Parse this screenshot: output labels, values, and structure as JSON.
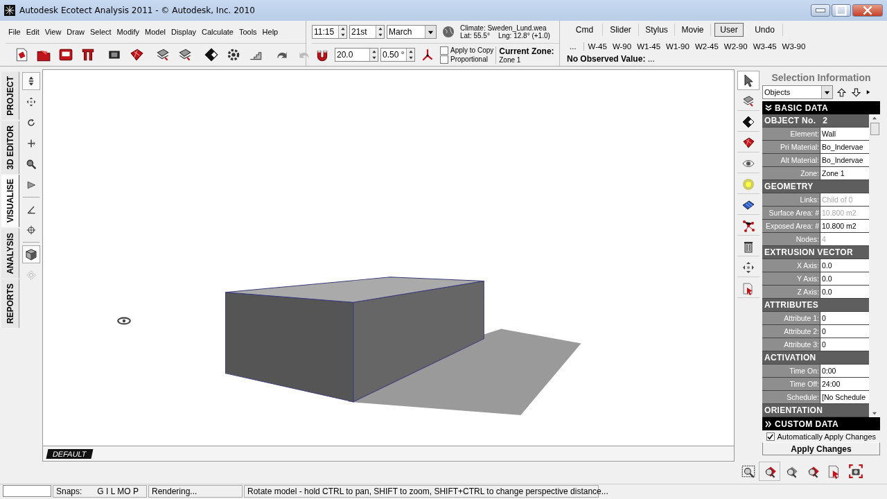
{
  "window": {
    "title": "Autodesk Ecotect Analysis 2011 - © Autodesk, Inc. 2010"
  },
  "menu": [
    "File",
    "Edit",
    "View",
    "Draw",
    "Select",
    "Modify",
    "Model",
    "Display",
    "Calculate",
    "Tools",
    "Help"
  ],
  "date_time": {
    "time": "11:15",
    "day": "21st",
    "month": "March"
  },
  "climate": {
    "file": "Climate: Sweden_Lund.wea",
    "lat": "Lat: 55.5°",
    "lng": "Lng: 12.8° (+1.0)"
  },
  "snap": {
    "distance": "20.0",
    "angle": "0.50 °",
    "options": [
      {
        "label": "Apply to Copy",
        "checked": false
      },
      {
        "label": "Proportional",
        "checked": false
      }
    ]
  },
  "current_zone": {
    "label": "Current Zone:",
    "value": "Zone 1"
  },
  "command_tabs": [
    {
      "label": "Cmd",
      "selected": false
    },
    {
      "label": "Slider",
      "selected": false
    },
    {
      "label": "Stylus",
      "selected": false
    },
    {
      "label": "Movie",
      "selected": false
    },
    {
      "label": "User",
      "selected": true
    },
    {
      "label": "Undo",
      "selected": false
    }
  ],
  "view_buttons": [
    "...",
    "W-45",
    "W-90",
    "W1-45",
    "W1-90",
    "W2-45",
    "W2-90",
    "W3-45",
    "W3-90"
  ],
  "observed_value": "**No Observed Value:** ...",
  "side_tabs": [
    {
      "label": "PROJECT",
      "selected": false
    },
    {
      "label": "3D EDITOR",
      "selected": false
    },
    {
      "label": "VISUALISE",
      "selected": true
    },
    {
      "label": "ANALYSIS",
      "selected": false
    },
    {
      "label": "REPORTS",
      "selected": false
    }
  ],
  "left_tools": [
    {
      "selected": true
    },
    {
      "selected": false
    },
    {
      "selected": false
    },
    {
      "selected": false
    },
    {
      "selected": false
    },
    {
      "selected": false
    },
    {
      "selected": false
    },
    {
      "selected": false
    },
    {
      "selected": true
    },
    {
      "selected": false
    }
  ],
  "viewport": {
    "layer_tab": "DEFAULT"
  },
  "right_tools": [
    {
      "selected": true
    },
    {
      "selected": false
    },
    {
      "selected": false
    },
    {
      "selected": false
    },
    {
      "selected": false
    },
    {
      "selected": false
    },
    {
      "selected": false
    },
    {
      "selected": false
    },
    {
      "selected": false
    },
    {
      "selected": false
    },
    {
      "selected": false
    }
  ],
  "selection_panel": {
    "title": "Selection Information",
    "filter": "Objects",
    "basic_data": {
      "title": "BASIC DATA",
      "expanded": true
    },
    "grid": [
      {
        "kind": "group",
        "title": "OBJECT No.",
        "value": "2"
      },
      {
        "kind": "row",
        "label": "Element:",
        "value": "Wall",
        "disabled": false
      },
      {
        "kind": "row",
        "label": "Pri Material:",
        "value": "Bo_Indervae",
        "disabled": false
      },
      {
        "kind": "row",
        "label": "Alt Material:",
        "value": "Bo_Indervae",
        "disabled": false
      },
      {
        "kind": "row",
        "label": "Zone:",
        "value": "Zone 1",
        "disabled": false
      },
      {
        "kind": "group",
        "title": "GEOMETRY"
      },
      {
        "kind": "row",
        "label": "Links:",
        "value": "Child of 0",
        "disabled": true
      },
      {
        "kind": "row",
        "label": "Surface Area: #",
        "value": "10.800 m2",
        "disabled": true
      },
      {
        "kind": "row",
        "label": "Exposed Area: #",
        "value": "10.800 m2",
        "disabled": false
      },
      {
        "kind": "row",
        "label": "Nodes:",
        "value": "4",
        "disabled": true
      },
      {
        "kind": "group",
        "title": "EXTRUSION VECTOR"
      },
      {
        "kind": "row",
        "label": "X Axis:",
        "value": "0.0",
        "disabled": false
      },
      {
        "kind": "row",
        "label": "Y Axis:",
        "value": "0.0",
        "disabled": false
      },
      {
        "kind": "row",
        "label": "Z Axis:",
        "value": "0.0",
        "disabled": false
      },
      {
        "kind": "group",
        "title": "ATTRIBUTES"
      },
      {
        "kind": "row",
        "label": "Attribute 1:",
        "value": "0",
        "disabled": false
      },
      {
        "kind": "row",
        "label": "Attribute 2:",
        "value": "0",
        "disabled": false
      },
      {
        "kind": "row",
        "label": "Attribute 3:",
        "value": "0",
        "disabled": false
      },
      {
        "kind": "group",
        "title": "ACTIVATION"
      },
      {
        "kind": "row",
        "label": "Time On:",
        "value": "0:00",
        "disabled": false
      },
      {
        "kind": "row",
        "label": "Time Off:",
        "value": "24:00",
        "disabled": false
      },
      {
        "kind": "row",
        "label": "Schedule:",
        "value": "[No Schedule",
        "disabled": false
      },
      {
        "kind": "group",
        "title": "ORIENTATION"
      }
    ],
    "custom_data": {
      "title": "CUSTOM DATA",
      "expanded": false
    },
    "auto_apply": {
      "label": "Automatically Apply Changes",
      "checked": true
    },
    "apply_button": "Apply Changes"
  },
  "status_bar": {
    "snaps_label": "Snaps:",
    "snaps": "G I L MO P",
    "status": "Rendering...",
    "hint": "Rotate model - hold CTRL to pan, SHIFT to zoom, SHIFT+CTRL to change perspective distance..."
  }
}
